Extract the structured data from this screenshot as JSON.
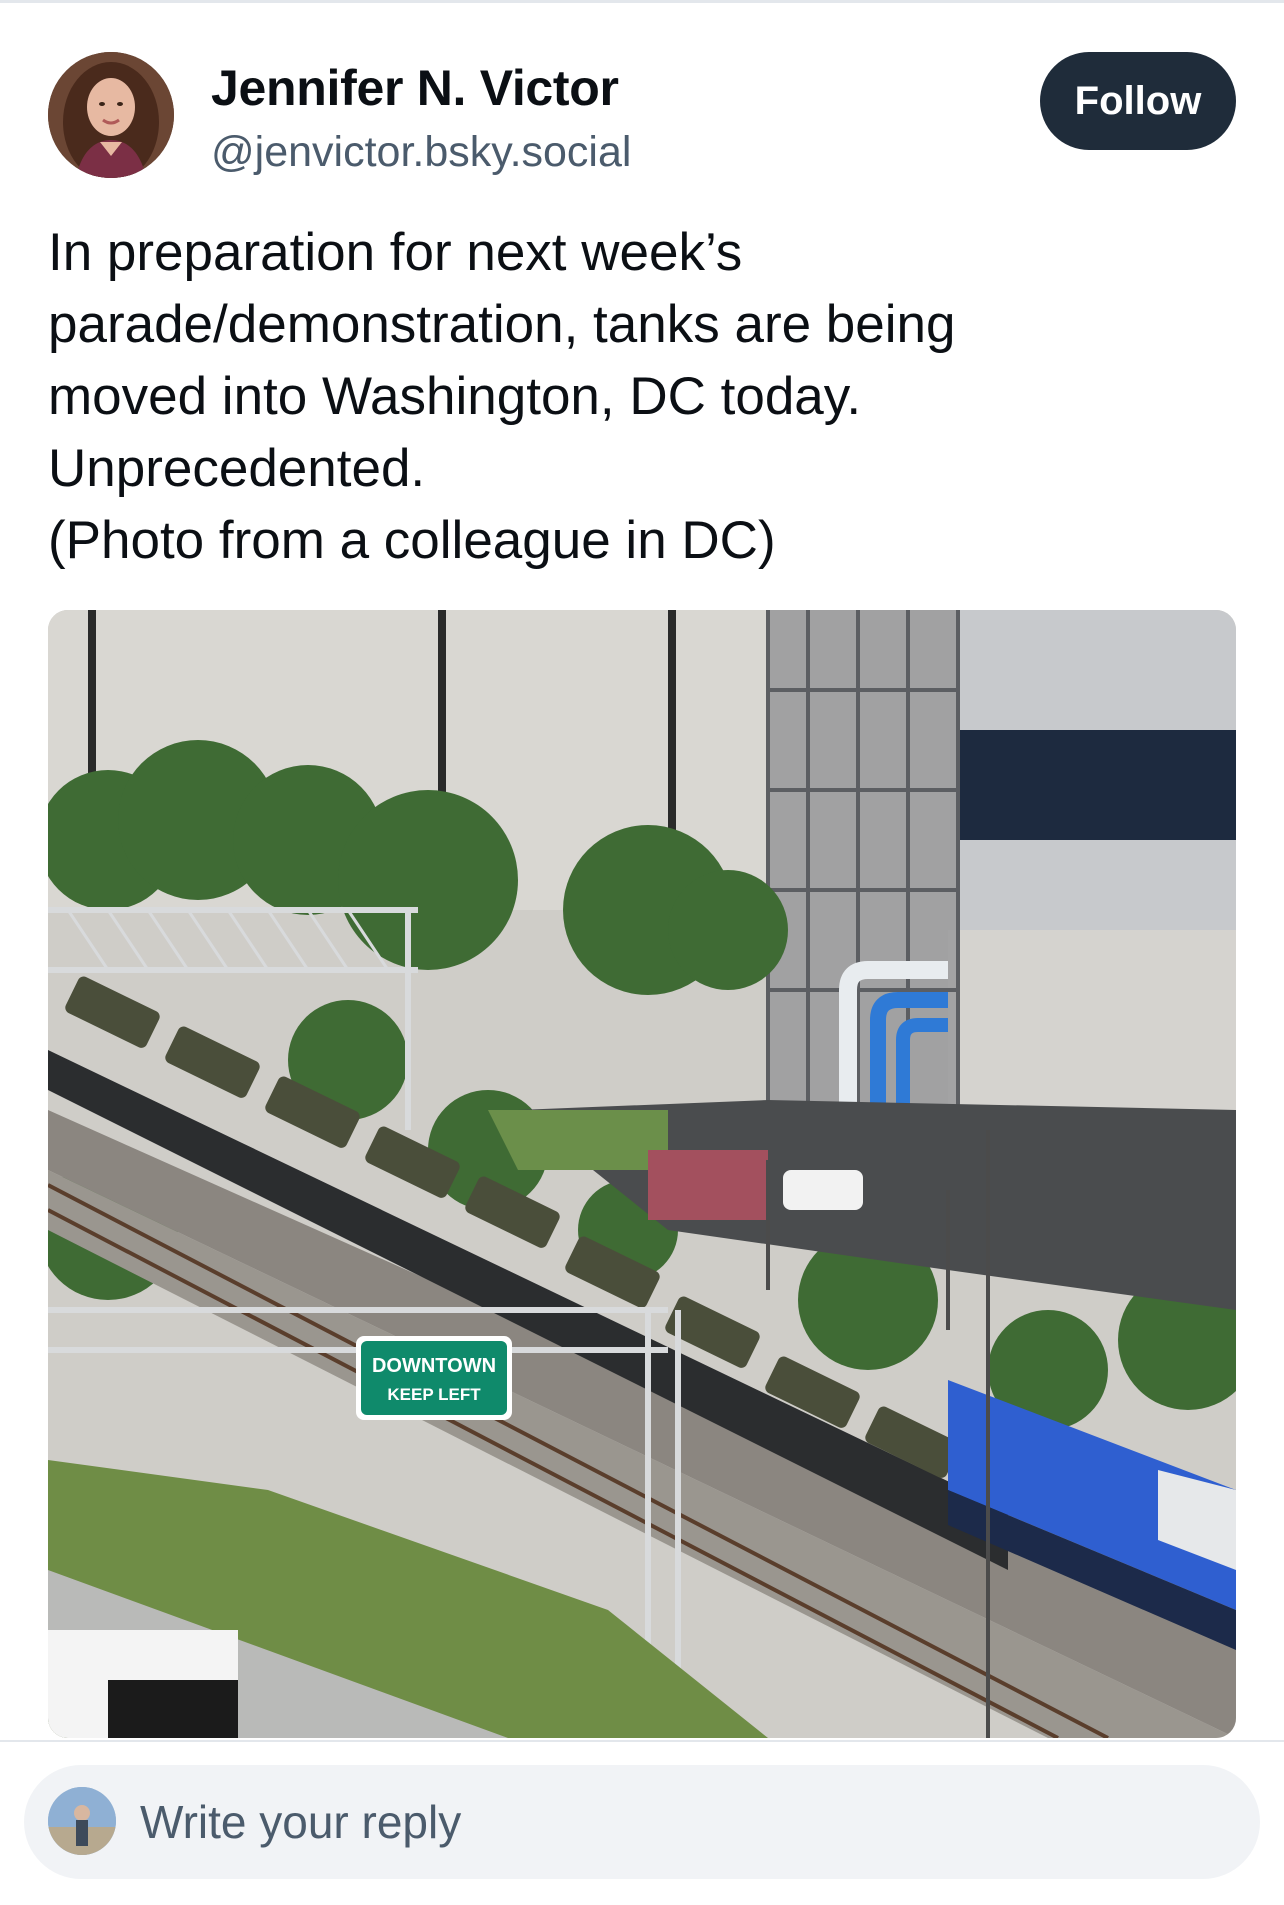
{
  "post": {
    "author": {
      "display_name": "Jennifer N. Victor",
      "handle": "@jenvictor.bsky.social"
    },
    "follow_label": "Follow",
    "text": "In preparation for next week’s\nparade/demonstration, tanks are being\nmoved into Washington, DC today.\nUnprecedented.\n(Photo from a colleague in DC)",
    "image": {
      "sign_line1": "DOWNTOWN",
      "sign_line2": "KEEP LEFT"
    }
  },
  "reply": {
    "placeholder": "Write your reply"
  },
  "colors": {
    "follow_bg": "#1f2c3a",
    "handle": "#4b5b6c",
    "reply_bg": "#f1f3f6",
    "sign_green": "#0f8a6b",
    "locomotive_blue": "#2f5fd0"
  }
}
